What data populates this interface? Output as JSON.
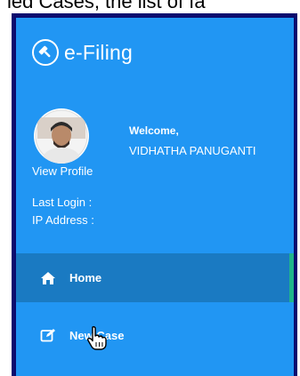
{
  "page_top_text": "led Cases, the list of fa",
  "brand": {
    "title": "e-Filing",
    "icon": "gavel-icon"
  },
  "profile": {
    "avatar": "avatar-photo",
    "view_profile_label": "View Profile",
    "welcome_label": "Welcome,",
    "user_name": "VIDHATHA PANUGANTI",
    "last_login_label": "Last Login :",
    "ip_address_label": "IP Address :"
  },
  "nav": {
    "items": [
      {
        "label": "Home",
        "icon": "home-icon",
        "active": true
      },
      {
        "label": "New Case",
        "icon": "edit-icon",
        "active": false
      }
    ]
  },
  "colors": {
    "sidebar_bg": "#2196f3",
    "active_item_bg": "#1a7ac2",
    "active_indicator": "#1fb58a",
    "frame_border": "#0b0b6e",
    "text": "#ffffff"
  },
  "cursor": "hand-pointer-cursor"
}
